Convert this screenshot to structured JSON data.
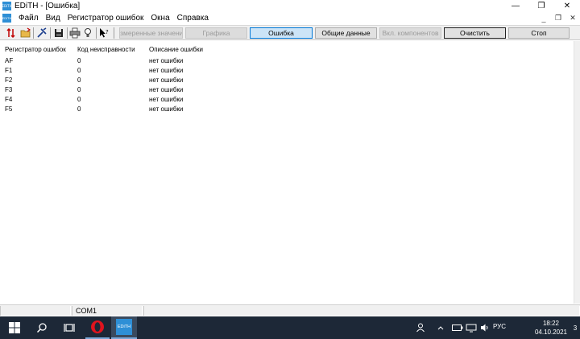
{
  "window": {
    "title": "EDiTH - [Ошибка]",
    "app_icon_text": "EDiTH",
    "minimize": "—",
    "maximize": "❐",
    "close": "✕"
  },
  "menu": {
    "items": [
      "Файл",
      "Вид",
      "Регистратор ошибок",
      "Окна",
      "Справка"
    ],
    "mdi_minimize": "_",
    "mdi_restore": "❐",
    "mdi_close": "✕"
  },
  "toolbar": {
    "buttons": [
      {
        "label": "Измеренные значения",
        "state": "disabled"
      },
      {
        "label": "Графика",
        "state": "disabled"
      },
      {
        "label": "Ошибка",
        "state": "active"
      },
      {
        "label": "Общие данные",
        "state": "normal"
      },
      {
        "label": "Вкл. компонентов",
        "state": "disabled"
      },
      {
        "label": "Очистить",
        "state": "normal"
      },
      {
        "label": "Стоп",
        "state": "normal"
      }
    ]
  },
  "table": {
    "headers": [
      "Регистратор ошибок",
      "Код неисправности",
      "Описание ошибки"
    ],
    "rows": [
      [
        "AF",
        "0",
        "нет ошибки"
      ],
      [
        "F1",
        "0",
        "нет ошибки"
      ],
      [
        "F2",
        "0",
        "нет ошибки"
      ],
      [
        "F3",
        "0",
        "нет ошибки"
      ],
      [
        "F4",
        "0",
        "нет ошибки"
      ],
      [
        "F5",
        "0",
        "нет ошибки"
      ]
    ]
  },
  "statusbar": {
    "port": "COM1"
  },
  "taskbar": {
    "edith_label": "EDiTH",
    "language": "РУС",
    "time": "18:22",
    "date": "04.10.2021",
    "notifications": "3"
  },
  "colors": {
    "accent": "#0078d7",
    "taskbar": "#1d2837",
    "opera": "#e0141e",
    "edith_icon": "#2e8fd6"
  }
}
